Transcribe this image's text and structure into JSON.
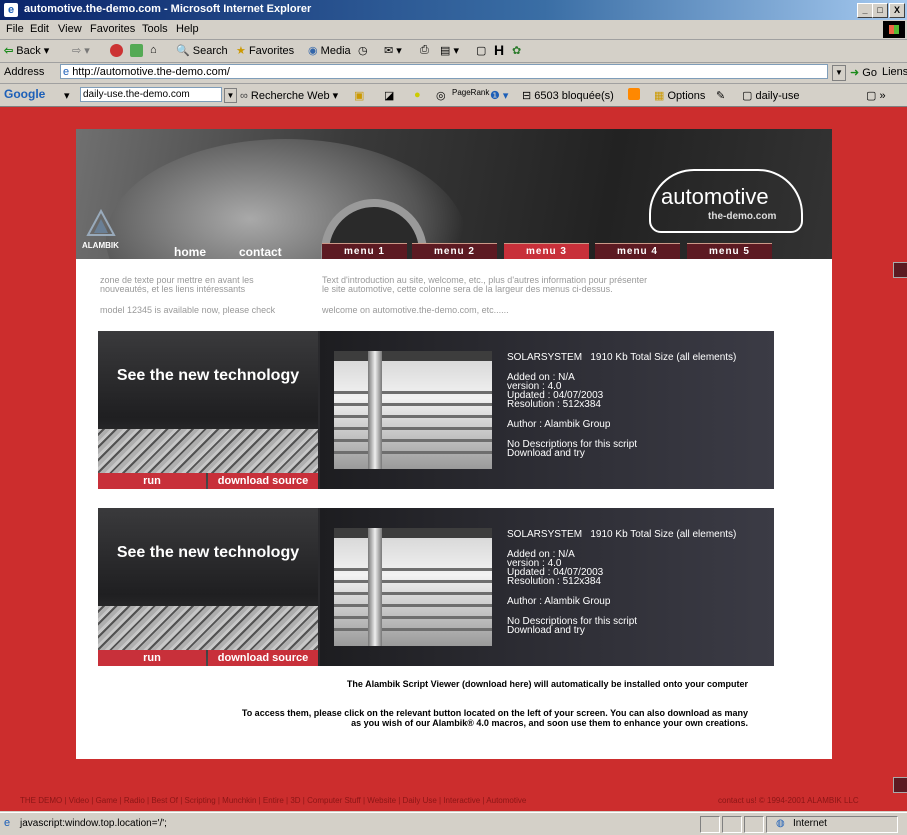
{
  "window": {
    "title": "automotive.the-demo.com - Microsoft Internet Explorer",
    "minimize": "_",
    "maximize": "□",
    "close": "X"
  },
  "menubar": [
    "File",
    "Edit",
    "View",
    "Favorites",
    "Tools",
    "Help"
  ],
  "toolbar": {
    "back": "Back",
    "search": "Search",
    "favorites": "Favorites",
    "media": "Media"
  },
  "address": {
    "label": "Address",
    "url": "http://automotive.the-demo.com/",
    "go": "Go",
    "links": "Liens"
  },
  "google_toolbar": {
    "brand": "Google",
    "query": "daily-use.the-demo.com",
    "search_web": "Recherche Web",
    "pagerank": "PageRank",
    "blocked": "6503 bloquée(s)",
    "options": "Options",
    "daily_use": "daily-use"
  },
  "site": {
    "logo_text": "automotive",
    "logo_sub": "the-demo.com",
    "alambik_label": "ALAMBIK",
    "nav": [
      "home",
      "contact"
    ],
    "menus": [
      "menu 1",
      "menu 2",
      "menu 3",
      "menu 4",
      "menu 5"
    ],
    "active_menu_index": 2,
    "intro_left_1": "zone de texte pour mettre en avant les",
    "intro_left_2": "nouveautés, et les liens intéressants",
    "intro_left_3": "model 12345 is available now, please check",
    "intro_right_1": "Text d'introduction au site, welcome, etc., plus d'autres information pour présenter",
    "intro_right_2": "le site automotive, cette colonne sera de la largeur des menus ci-dessus.",
    "intro_right_3": "welcome on automotive.the-demo.com, etc......",
    "cards": [
      {
        "promo_title": "See the new technology",
        "run": "run",
        "download": "download source",
        "name": "SOLARSYSTEM",
        "size": "1910 Kb Total Size (all elements)",
        "added": "Added on : N/A",
        "version": "version : 4.0",
        "updated": "Updated : 04/07/2003",
        "resolution": "Resolution : 512x384",
        "author": "Author : Alambik Group",
        "desc1": "No Descriptions for this script",
        "desc2": "Download and try"
      },
      {
        "promo_title": "See the new technology",
        "run": "run",
        "download": "download source",
        "name": "SOLARSYSTEM",
        "size": "1910 Kb Total Size (all elements)",
        "added": "Added on : N/A",
        "version": "version : 4.0",
        "updated": "Updated : 04/07/2003",
        "resolution": "Resolution : 512x384",
        "author": "Author : Alambik Group",
        "desc1": "No Descriptions for this script",
        "desc2": "Download and try"
      }
    ],
    "footer_1": "The Alambik Script Viewer (download here) will automatically be installed onto your computer",
    "footer_2": "To access them, please click on the relevant button located on the left of your screen. You can also download as many",
    "footer_3": "as you wish of our Alambik® 4.0 macros, and soon use them to enhance your own creations.",
    "bottom_links": "THE DEMO | Video | Game | Radio | Best Of | Scripting | Munchkin | Entire | 3D | Computer Stuff | Website | Daily Use | Interactive | Automotive",
    "bottom_right": "contact us!   © 1994-2001 ALAMBIK LLC"
  },
  "statusbar": {
    "text": "javascript:window.top.location='/';",
    "zone": "Internet"
  }
}
